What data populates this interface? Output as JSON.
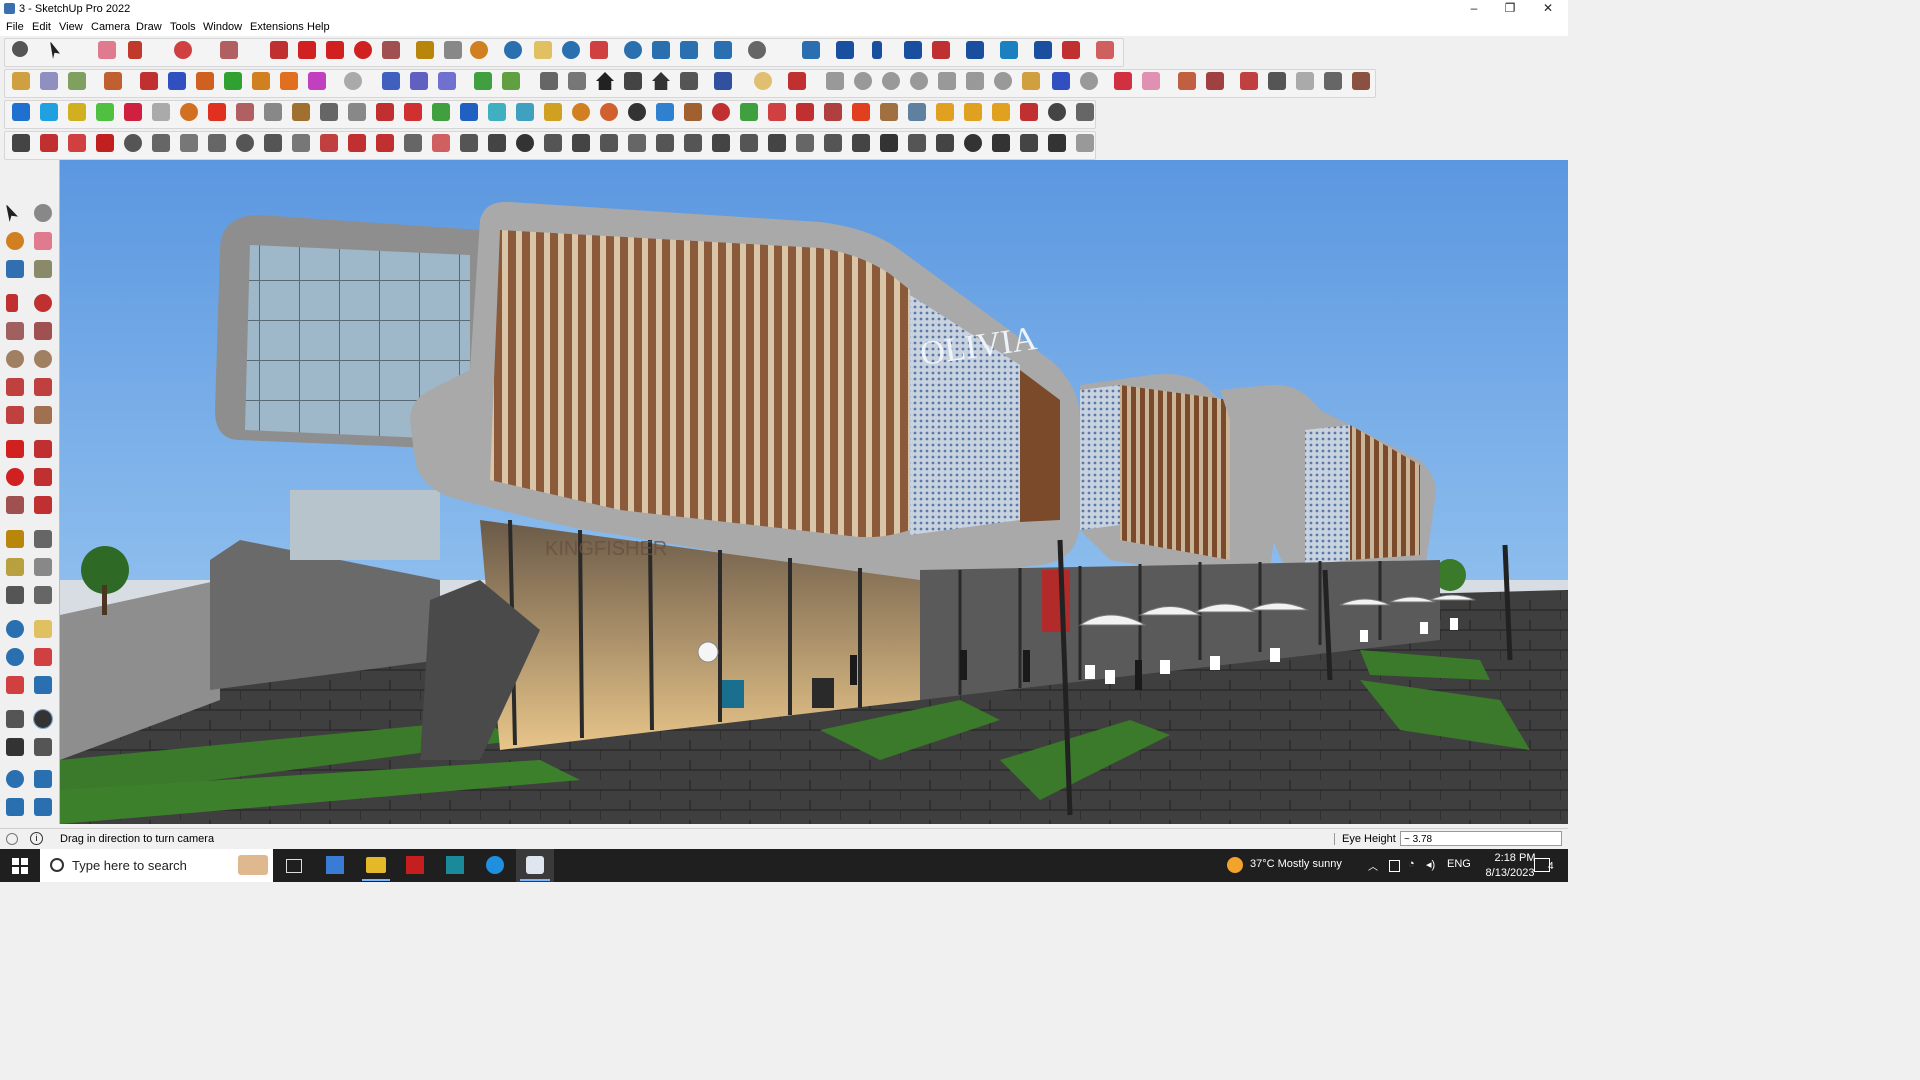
{
  "window": {
    "title": "3 - SketchUp Pro 2022",
    "minimize": "–",
    "restore": "❐",
    "close": "✕"
  },
  "menu": {
    "items": [
      "File",
      "Edit",
      "View",
      "Camera",
      "Draw",
      "Tools",
      "Window",
      "Extensions",
      "Help"
    ]
  },
  "viewport": {
    "storefront_sign": "KINGFISHER",
    "banner_text": "OLIVIA"
  },
  "status": {
    "hint": "Drag in direction to turn camera",
    "eye_height_label": "Eye Height",
    "eye_height_value": "~ 3.78"
  },
  "taskbar": {
    "search_placeholder": "Type here to search",
    "weather": "37°C  Mostly sunny",
    "language": "ENG",
    "time": "2:18 PM",
    "date": "8/13/2023",
    "notification_count": "4"
  },
  "colors": {
    "sky": "#6ea6e8",
    "facade": "#9e9e9e",
    "wood": "#8a5a3a",
    "ground": "#4a4a4a"
  }
}
